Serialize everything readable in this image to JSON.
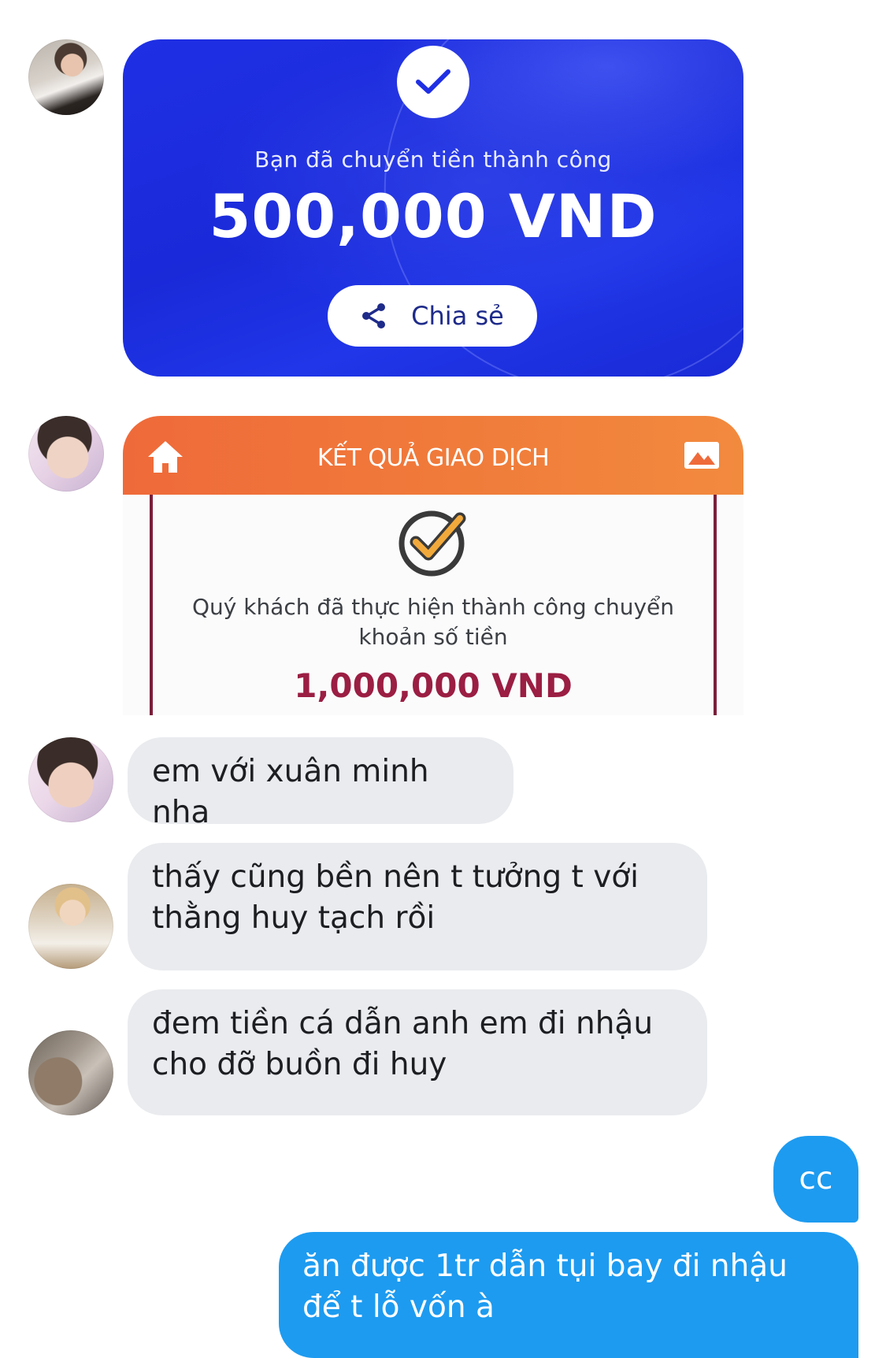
{
  "messages": {
    "card_transfer": {
      "title": "Bạn đã chuyển tiền thành công",
      "amount": "500,000 VND",
      "share_label": "Chia sẻ",
      "accent": "#1f2fe4"
    },
    "card_result": {
      "header": "KẾT QUẢ GIAO DỊCH",
      "text": "Quý khách đã thực hiện thành công chuyển khoản số tiền",
      "amount": "1,000,000 VND",
      "accent": "#ef6a3a",
      "amount_color": "#9b1e43"
    },
    "received": [
      {
        "text": "em với xuân minh nha"
      },
      {
        "text": "thấy cũng bền nên t tưởng t với thằng huy tạch rồi"
      },
      {
        "text": "đem tiền cá dẫn anh em đi nhậu cho đỡ buồn đi huy"
      }
    ],
    "sent": [
      {
        "text": "cc"
      },
      {
        "text": "ăn được 1tr dẫn tụi bay đi nhậu để t lỗ vốn à"
      }
    ]
  },
  "colors": {
    "received_bubble": "#e9ebee",
    "sent_bubble": "#1d9bf0"
  },
  "icons": [
    "check-icon",
    "share-icon",
    "home-icon",
    "image-icon",
    "check-circle-icon"
  ]
}
